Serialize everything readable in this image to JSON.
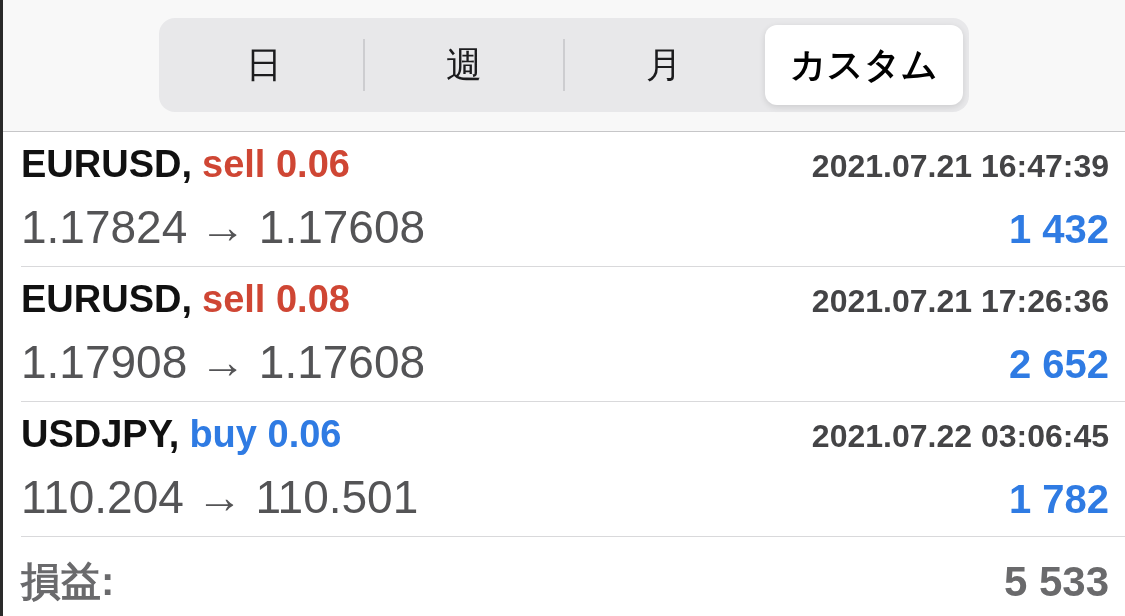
{
  "period_tabs": [
    {
      "label": "日",
      "selected": false
    },
    {
      "label": "週",
      "selected": false
    },
    {
      "label": "月",
      "selected": false
    },
    {
      "label": "カスタム",
      "selected": true
    }
  ],
  "trades": [
    {
      "symbol": "EURUSD,",
      "kind": "sell",
      "order": "sell 0.06",
      "time": "2021.07.21 16:47:39",
      "prices": "1.17824 → 1.17608",
      "profit": "1 432"
    },
    {
      "symbol": "EURUSD,",
      "kind": "sell",
      "order": "sell 0.08",
      "time": "2021.07.21 17:26:36",
      "prices": "1.17908 → 1.17608",
      "profit": "2 652"
    },
    {
      "symbol": "USDJPY,",
      "kind": "buy",
      "order": "buy 0.06",
      "time": "2021.07.22 03:06:45",
      "prices": "110.204 → 110.501",
      "profit": "1 782"
    }
  ],
  "total": {
    "label": "損益:",
    "value": "5 533"
  }
}
